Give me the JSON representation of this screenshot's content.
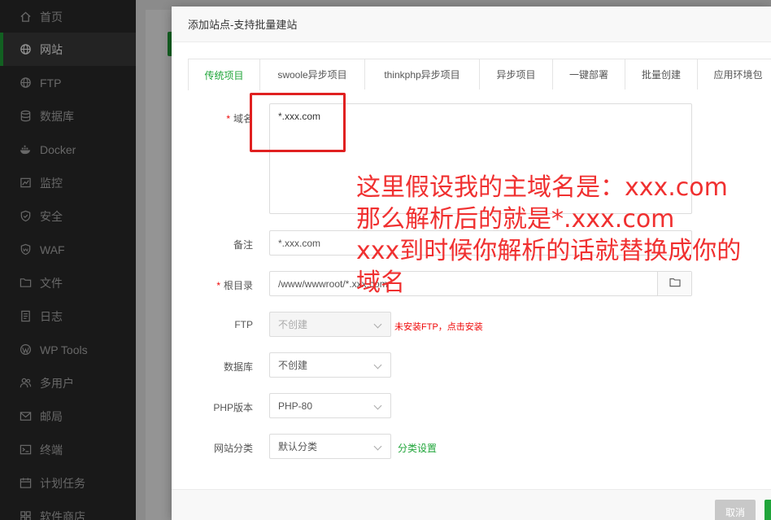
{
  "sidebar": {
    "items": [
      {
        "label": "首页",
        "icon": "home-icon",
        "active": false
      },
      {
        "label": "网站",
        "icon": "globe-icon",
        "active": true
      },
      {
        "label": "FTP",
        "icon": "globe-icon",
        "active": false
      },
      {
        "label": "数据库",
        "icon": "database-icon",
        "active": false
      },
      {
        "label": "Docker",
        "icon": "docker-icon",
        "active": false
      },
      {
        "label": "监控",
        "icon": "monitor-icon",
        "active": false
      },
      {
        "label": "安全",
        "icon": "shield-icon",
        "active": false
      },
      {
        "label": "WAF",
        "icon": "waf-shield-icon",
        "active": false
      },
      {
        "label": "文件",
        "icon": "folder-icon",
        "active": false
      },
      {
        "label": "日志",
        "icon": "log-icon",
        "active": false
      },
      {
        "label": "WP Tools",
        "icon": "wordpress-icon",
        "active": false
      },
      {
        "label": "多用户",
        "icon": "users-icon",
        "active": false
      },
      {
        "label": "邮局",
        "icon": "mail-icon",
        "active": false
      },
      {
        "label": "终端",
        "icon": "terminal-icon",
        "active": false
      },
      {
        "label": "计划任务",
        "icon": "calendar-icon",
        "active": false
      },
      {
        "label": "软件商店",
        "icon": "store-icon",
        "active": false
      }
    ]
  },
  "modal": {
    "title": "添加站点-支持批量建站",
    "tabs": [
      {
        "label": "传统项目",
        "active": true
      },
      {
        "label": "swoole异步项目",
        "active": false
      },
      {
        "label": "thinkphp异步项目",
        "active": false
      },
      {
        "label": "异步项目",
        "active": false
      },
      {
        "label": "一键部署",
        "active": false
      },
      {
        "label": "批量创建",
        "active": false
      },
      {
        "label": "应用环境包",
        "active": false
      }
    ],
    "form": {
      "domain_required": "*",
      "domain_label": "域名",
      "domain_value": "*.xxx.com",
      "remark_label": "备注",
      "remark_value": "*.xxx.com",
      "root_required": "*",
      "root_label": "根目录",
      "root_value": "/www/wwwroot/*.xxx.com",
      "ftp_label": "FTP",
      "ftp_value": "不创建",
      "ftp_hint": "未安装FTP，点击安装",
      "db_label": "数据库",
      "db_value": "不创建",
      "php_label": "PHP版本",
      "php_value": "PHP-80",
      "category_label": "网站分类",
      "category_value": "默认分类",
      "category_link": "分类设置"
    },
    "footer": {
      "cancel_label": "取消"
    }
  },
  "annotation": {
    "text": "这里假设我的主域名是：xxx.com\n那么解析后的就是*.xxx.com\nxxx到时候你解析的话就替换成你的\n域名"
  },
  "colors": {
    "accent": "#20a53a",
    "required": "#ef0808",
    "annotation": "#f03030"
  }
}
